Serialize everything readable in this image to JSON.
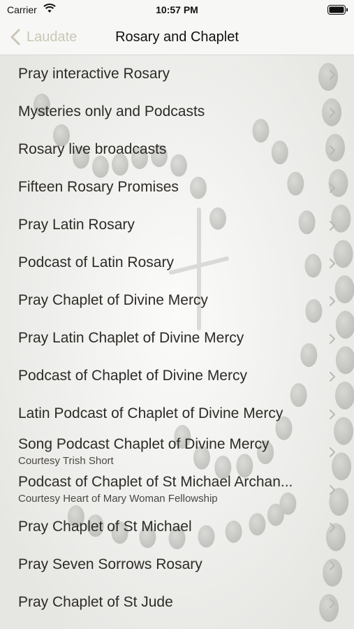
{
  "status_bar": {
    "carrier": "Carrier",
    "time": "10:57 PM"
  },
  "nav": {
    "back_label": "Laudate",
    "title": "Rosary and Chaplet"
  },
  "items": [
    {
      "title": "Pray interactive Rosary",
      "subtitle": ""
    },
    {
      "title": "Mysteries only and Podcasts",
      "subtitle": ""
    },
    {
      "title": "Rosary live broadcasts",
      "subtitle": ""
    },
    {
      "title": "Fifteen Rosary Promises",
      "subtitle": ""
    },
    {
      "title": "Pray Latin Rosary",
      "subtitle": ""
    },
    {
      "title": "Podcast of Latin Rosary",
      "subtitle": ""
    },
    {
      "title": "Pray Chaplet of Divine Mercy",
      "subtitle": ""
    },
    {
      "title": "Pray Latin Chaplet of Divine Mercy",
      "subtitle": ""
    },
    {
      "title": "Podcast of Chaplet of Divine Mercy",
      "subtitle": ""
    },
    {
      "title": "Latin Podcast of Chaplet of Divine Mercy",
      "subtitle": ""
    },
    {
      "title": "Song Podcast Chaplet of Divine Mercy",
      "subtitle": "Courtesy Trish Short"
    },
    {
      "title": "Podcast of Chaplet of St Michael Archan...",
      "subtitle": "Courtesy Heart of Mary Woman Fellowship"
    },
    {
      "title": "Pray Chaplet of St Michael",
      "subtitle": ""
    },
    {
      "title": "Pray Seven Sorrows Rosary",
      "subtitle": ""
    },
    {
      "title": "Pray Chaplet of St Jude",
      "subtitle": ""
    }
  ],
  "icons": {
    "back": "chevron-left-icon",
    "row": "chevron-right-icon",
    "wifi": "wifi-icon",
    "battery": "battery-icon"
  },
  "colors": {
    "accent": "#cac6b6",
    "text": "#2d2b26",
    "background": "#f1f1ef"
  }
}
